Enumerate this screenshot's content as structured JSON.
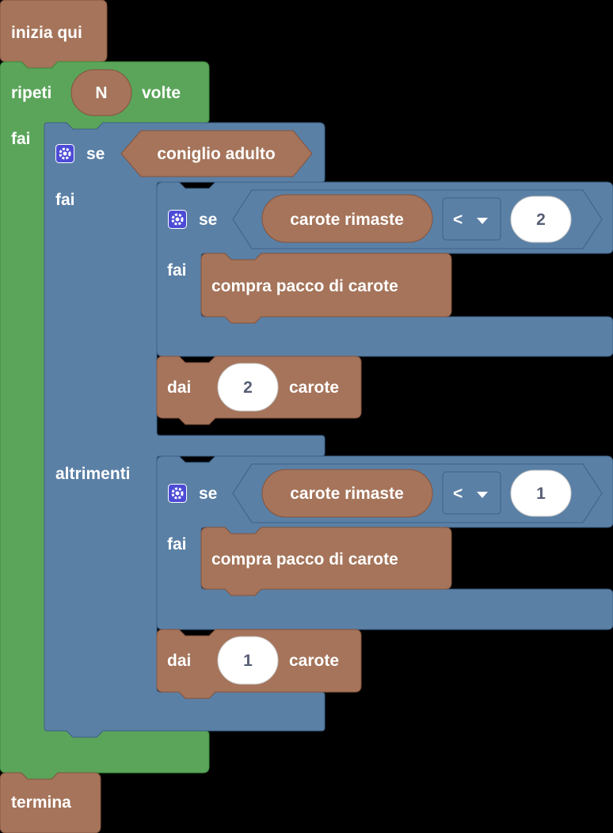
{
  "start_block": {
    "label": "inizia qui"
  },
  "repeat_block": {
    "label_before": "ripeti",
    "count": "N",
    "label_after": "volte",
    "do_label": "fai"
  },
  "if_else_block": {
    "if_label": "se",
    "condition": "coniglio adulto",
    "do_label": "fai",
    "else_label": "altrimenti"
  },
  "inner_if_1": {
    "if_label": "se",
    "left": "carote rimaste",
    "operator": "<",
    "right": "2",
    "do_label": "fai",
    "action": "compra pacco di carote"
  },
  "give_1": {
    "label_before": "dai",
    "amount": "2",
    "label_after": "carote"
  },
  "inner_if_2": {
    "if_label": "se",
    "left": "carote rimaste",
    "operator": "<",
    "right": "1",
    "do_label": "fai",
    "action": "compra pacco di carote"
  },
  "give_2": {
    "label_before": "dai",
    "amount": "1",
    "label_after": "carote"
  },
  "end_block": {
    "label": "termina"
  },
  "colors": {
    "event": "#a5745a",
    "loop": "#5ba55b",
    "logic": "#5b80a5",
    "value": "#ffffff",
    "background": "#000000",
    "gear": "#4b4bd6"
  }
}
